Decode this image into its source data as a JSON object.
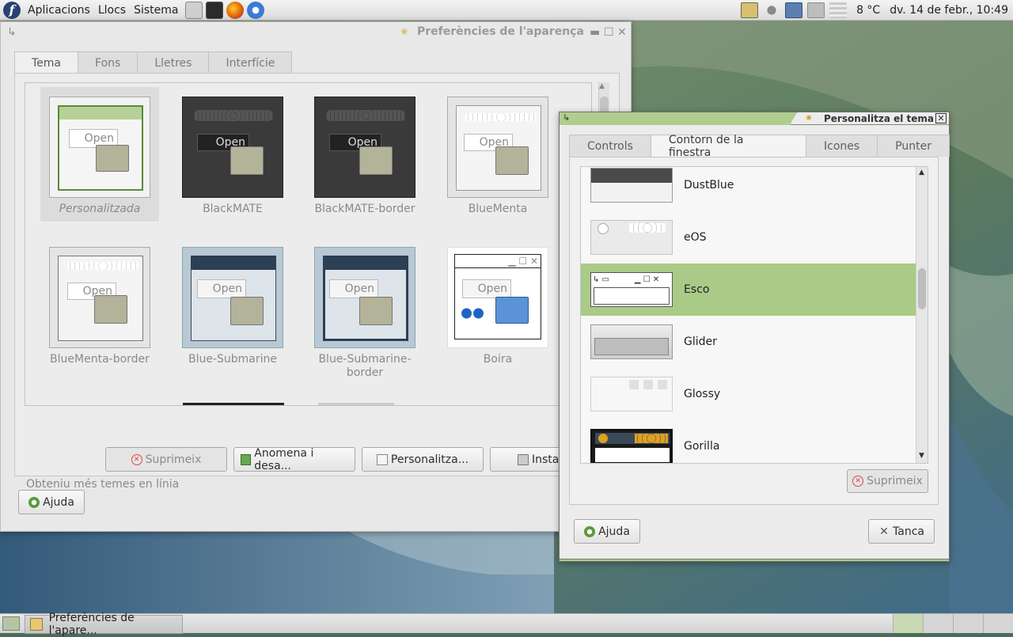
{
  "top_panel": {
    "menus": [
      "Aplicacions",
      "Llocs",
      "Sistema"
    ],
    "temperature": "8 °C",
    "clock": "dv. 14 de febr., 10:49"
  },
  "prefs_window": {
    "title": "Preferències de l'aparença",
    "tabs": [
      "Tema",
      "Fons",
      "Lletres",
      "Interfície"
    ],
    "active_tab": "Tema",
    "themes": [
      {
        "name": "Personalitzada"
      },
      {
        "name": "BlackMATE"
      },
      {
        "name": "BlackMATE-border"
      },
      {
        "name": "BlueMenta"
      },
      {
        "name": "BlueMenta-border"
      },
      {
        "name": "Blue-Submarine"
      },
      {
        "name": "Blue-Submarine-border"
      },
      {
        "name": "Boira"
      }
    ],
    "thumb_open_label": "Open",
    "buttons": {
      "delete": "Suprimeix",
      "rename": "Anomena i desa...",
      "customize": "Personalitza...",
      "install": "Instal"
    },
    "online_link": "Obteniu més temes en línia",
    "help": "Ajuda"
  },
  "custom_window": {
    "title": "Personalitza el tema",
    "tabs": [
      "Controls",
      "Contorn de la finestra",
      "Icones",
      "Punter"
    ],
    "active_tab": "Contorn de la finestra",
    "frames": [
      {
        "name": "DustBlue"
      },
      {
        "name": "eOS"
      },
      {
        "name": "Esco"
      },
      {
        "name": "Glider"
      },
      {
        "name": "Glossy"
      },
      {
        "name": "Gorilla"
      }
    ],
    "selected_frame": "Esco",
    "delete": "Suprimeix",
    "help": "Ajuda",
    "close": "Tanca"
  },
  "taskbar": {
    "window_button": "Preferències de l'apare..."
  },
  "colors": {
    "selection_green": "#a9cb87",
    "panel": "#e0e0e0"
  }
}
